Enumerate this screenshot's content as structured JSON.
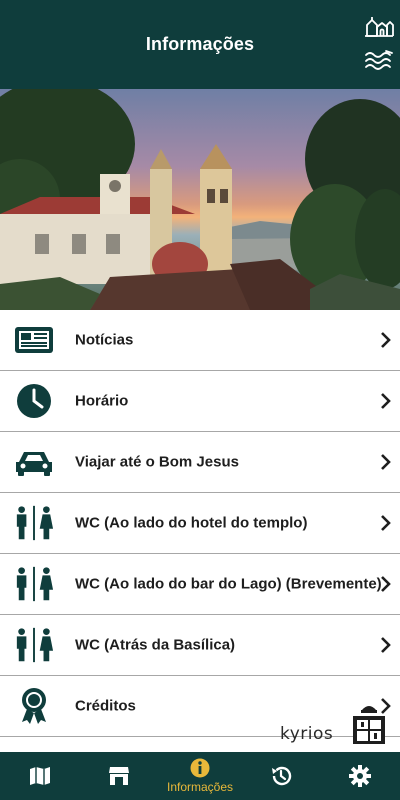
{
  "header": {
    "title": "Informações",
    "icons": [
      "church-icon",
      "lake-icon"
    ]
  },
  "hero": {
    "image": "basilica-photo",
    "badge_icon": "unesco-heritage-icon"
  },
  "menu": {
    "items": [
      {
        "label": "Notícias",
        "icon": "newspaper-icon"
      },
      {
        "label": "Horário",
        "icon": "clock-icon"
      },
      {
        "label": "Viajar até o Bom Jesus",
        "icon": "car-icon"
      },
      {
        "label": " WC (Ao lado do hotel do templo)",
        "icon": "restroom-icon"
      },
      {
        "label": "WC (Ao lado do bar do Lago) (Brevemente)",
        "icon": "restroom-icon"
      },
      {
        "label": "WC (Atrás da Basílica)",
        "icon": "restroom-icon"
      },
      {
        "label": "Créditos",
        "icon": "award-icon"
      }
    ]
  },
  "brand": {
    "text": "kyrios"
  },
  "tabbar": {
    "tabs": [
      {
        "label": "",
        "icon": "map-icon"
      },
      {
        "label": "",
        "icon": "store-icon"
      },
      {
        "label": "Informações",
        "icon": "info-icon",
        "active": true
      },
      {
        "label": "",
        "icon": "history-icon"
      },
      {
        "label": "",
        "icon": "settings-icon"
      }
    ],
    "active_color": "#e8b83a",
    "background": "#0f3d3c"
  },
  "colors": {
    "primary": "#0f3d3c",
    "text": "#1e1e1e"
  }
}
